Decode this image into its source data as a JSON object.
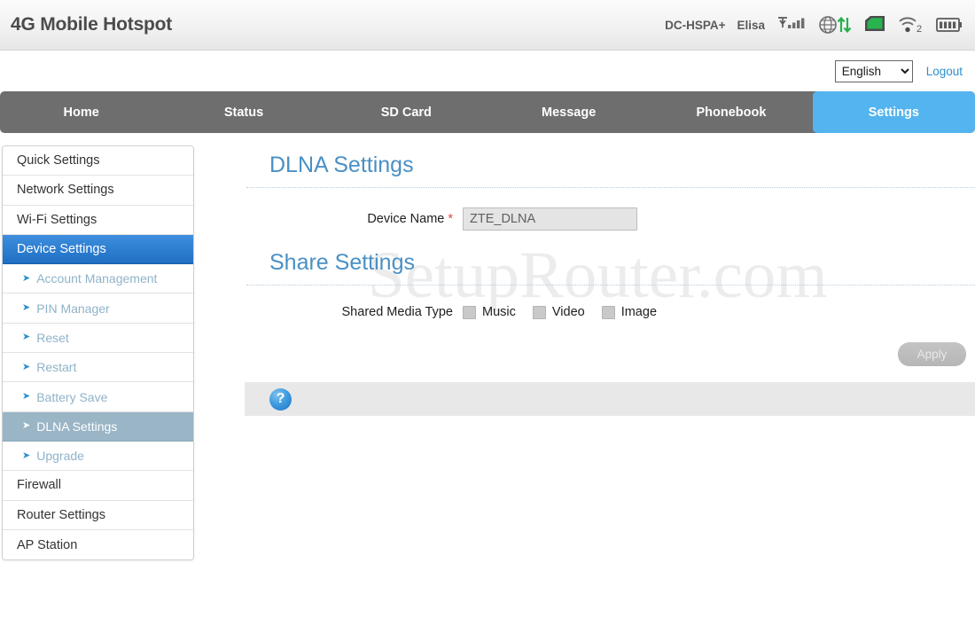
{
  "header": {
    "app_title": "4G Mobile Hotspot",
    "network_type": "DC-HSPA+",
    "carrier": "Elisa",
    "icons": [
      {
        "name": "signal-bars-icon",
        "label": "signal"
      },
      {
        "name": "globe-data-transfer-icon",
        "label": "data-transfer"
      },
      {
        "name": "sd-card-icon",
        "label": "sd-card"
      },
      {
        "name": "wifi-clients-icon",
        "label": "wifi",
        "badge": "2"
      },
      {
        "name": "battery-icon",
        "label": "battery"
      }
    ]
  },
  "lang_bar": {
    "selected_language": "English",
    "language_options": [
      "English"
    ],
    "logout_label": "Logout"
  },
  "nav": {
    "items": [
      {
        "label": "Home",
        "active": false
      },
      {
        "label": "Status",
        "active": false
      },
      {
        "label": "SD Card",
        "active": false
      },
      {
        "label": "Message",
        "active": false
      },
      {
        "label": "Phonebook",
        "active": false
      },
      {
        "label": "Settings",
        "active": true
      }
    ]
  },
  "sidebar": {
    "items": [
      {
        "label": "Quick Settings",
        "type": "top",
        "state": "normal"
      },
      {
        "label": "Network Settings",
        "type": "top",
        "state": "normal"
      },
      {
        "label": "Wi-Fi Settings",
        "type": "top",
        "state": "normal"
      },
      {
        "label": "Device Settings",
        "type": "top",
        "state": "selected"
      },
      {
        "label": "Account Management",
        "type": "sub",
        "state": "normal"
      },
      {
        "label": "PIN Manager",
        "type": "sub",
        "state": "normal"
      },
      {
        "label": "Reset",
        "type": "sub",
        "state": "normal"
      },
      {
        "label": "Restart",
        "type": "sub",
        "state": "normal"
      },
      {
        "label": "Battery Save",
        "type": "sub",
        "state": "normal"
      },
      {
        "label": "DLNA Settings",
        "type": "sub",
        "state": "selected"
      },
      {
        "label": "Upgrade",
        "type": "sub",
        "state": "normal"
      },
      {
        "label": "Firewall",
        "type": "top",
        "state": "normal"
      },
      {
        "label": "Router Settings",
        "type": "top",
        "state": "normal"
      },
      {
        "label": "AP Station",
        "type": "top",
        "state": "normal"
      }
    ]
  },
  "main": {
    "dlna_section": {
      "title": "DLNA Settings",
      "device_name_label": "Device Name",
      "required_marker": "*",
      "device_name_value": "ZTE_DLNA"
    },
    "share_section": {
      "title": "Share Settings",
      "shared_media_label": "Shared Media Type",
      "media_types": [
        {
          "label": "Music",
          "checked": false
        },
        {
          "label": "Video",
          "checked": false
        },
        {
          "label": "Image",
          "checked": false
        }
      ]
    },
    "apply_label": "Apply",
    "help_icon_glyph": "?"
  },
  "watermark": {
    "text": "SetupRouter.com"
  },
  "colors": {
    "accent_blue": "#54b4ef",
    "nav_gray": "#6e6e6e",
    "title_blue": "#4a90c4",
    "selected_sidebar": "#1f6fc4",
    "sub_selected": "#9ab5c6",
    "required_red": "#e0444b",
    "link_blue": "#2d8fd0"
  }
}
